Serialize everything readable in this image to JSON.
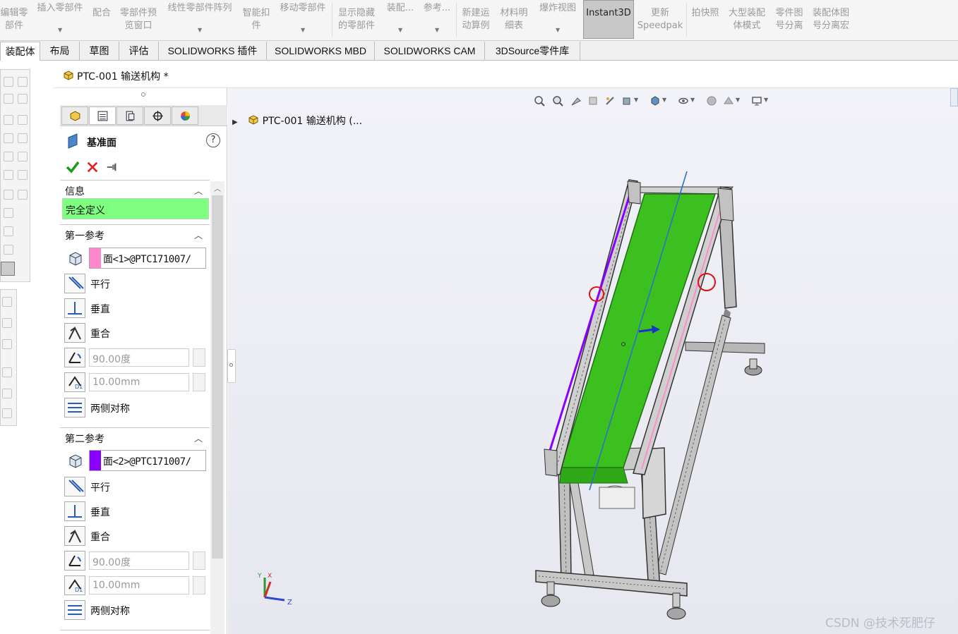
{
  "ribbon": {
    "buttons": [
      {
        "l1": "编辑零",
        "l2": "部件"
      },
      {
        "l1": "插入零部件",
        "l2": ""
      },
      {
        "l1": "配合",
        "l2": ""
      },
      {
        "l1": "零部件预",
        "l2": "览窗口"
      },
      {
        "l1": "线性零部件阵列",
        "l2": ""
      },
      {
        "l1": "智能扣",
        "l2": "件"
      },
      {
        "l1": "移动零部件",
        "l2": ""
      },
      {
        "l1": "显示隐藏",
        "l2": "的零部件"
      },
      {
        "l1": "装配...",
        "l2": ""
      },
      {
        "l1": "参考...",
        "l2": ""
      },
      {
        "l1": "新建运",
        "l2": "动算例"
      },
      {
        "l1": "材料明",
        "l2": "细表"
      },
      {
        "l1": "爆炸视图",
        "l2": ""
      },
      {
        "l1": "更新",
        "l2": "Speedpak"
      },
      {
        "l1": "拍快照",
        "l2": ""
      },
      {
        "l1": "大型装配",
        "l2": "体模式"
      },
      {
        "l1": "零件图",
        "l2": "号分离"
      },
      {
        "l1": "装配体图",
        "l2": "号分离宏"
      }
    ],
    "instant3d": "Instant3D"
  },
  "tabs": [
    "装配体",
    "布局",
    "草图",
    "评估",
    "SOLIDWORKS 插件",
    "SOLIDWORKS MBD",
    "SOLIDWORKS CAM",
    "3DSource零件库"
  ],
  "document": {
    "title": "PTC-001 输送机构 *",
    "tree_crumb": "PTC-001 输送机构 (..."
  },
  "property_manager": {
    "title": "基准面",
    "help": "?",
    "sections": {
      "info": {
        "label": "信息",
        "status": "完全定义"
      },
      "first_ref": {
        "label": "第一参考",
        "reference": "面<1>@PTC171007/",
        "swatch_color": "#ff88cc",
        "parallel": "平行",
        "perpendicular": "垂直",
        "coincident": "重合",
        "angle": "90.00度",
        "distance": "10.00mm",
        "symmetric": "两侧对称"
      },
      "second_ref": {
        "label": "第二参考",
        "reference": "面<2>@PTC171007/",
        "swatch_color": "#8a00ff",
        "parallel": "平行",
        "perpendicular": "垂直",
        "coincident": "重合",
        "angle": "90.00度",
        "distance": "10.00mm",
        "symmetric": "两侧对称"
      }
    }
  },
  "triad": {
    "y": "Y",
    "x": "X",
    "z": "Z"
  },
  "watermark": "CSDN @技术死肥仔",
  "colors": {
    "belt": "#3cc020",
    "status_ok": "#7fff7f",
    "frame": "#8c8c8c"
  }
}
